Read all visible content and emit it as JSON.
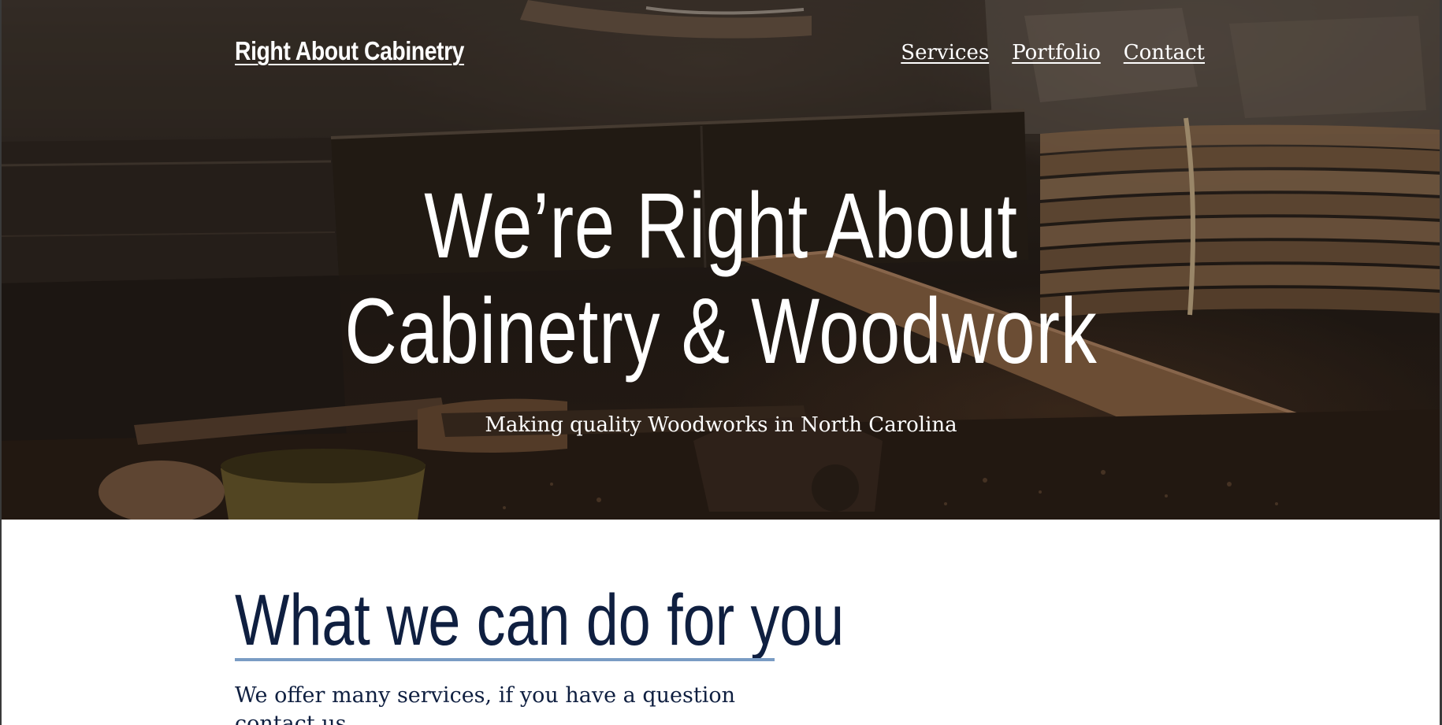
{
  "header": {
    "logo_text": "Right About Cabinetry",
    "nav": [
      {
        "label": "Services"
      },
      {
        "label": "Portfolio"
      },
      {
        "label": "Contact"
      }
    ]
  },
  "hero": {
    "title_line1": "We’re Right About",
    "title_line2": "Cabinetry & Woodwork",
    "subtitle": "Making quality Woodworks in North Carolina",
    "background": "workshop-tools-photo"
  },
  "services": {
    "heading": "What we can do for you",
    "description": "We offer many services, if you have a question contact us."
  },
  "colors": {
    "heading_navy": "#0f1f40",
    "underline_blue": "#7a9cc4",
    "hero_text": "#ffffff"
  }
}
